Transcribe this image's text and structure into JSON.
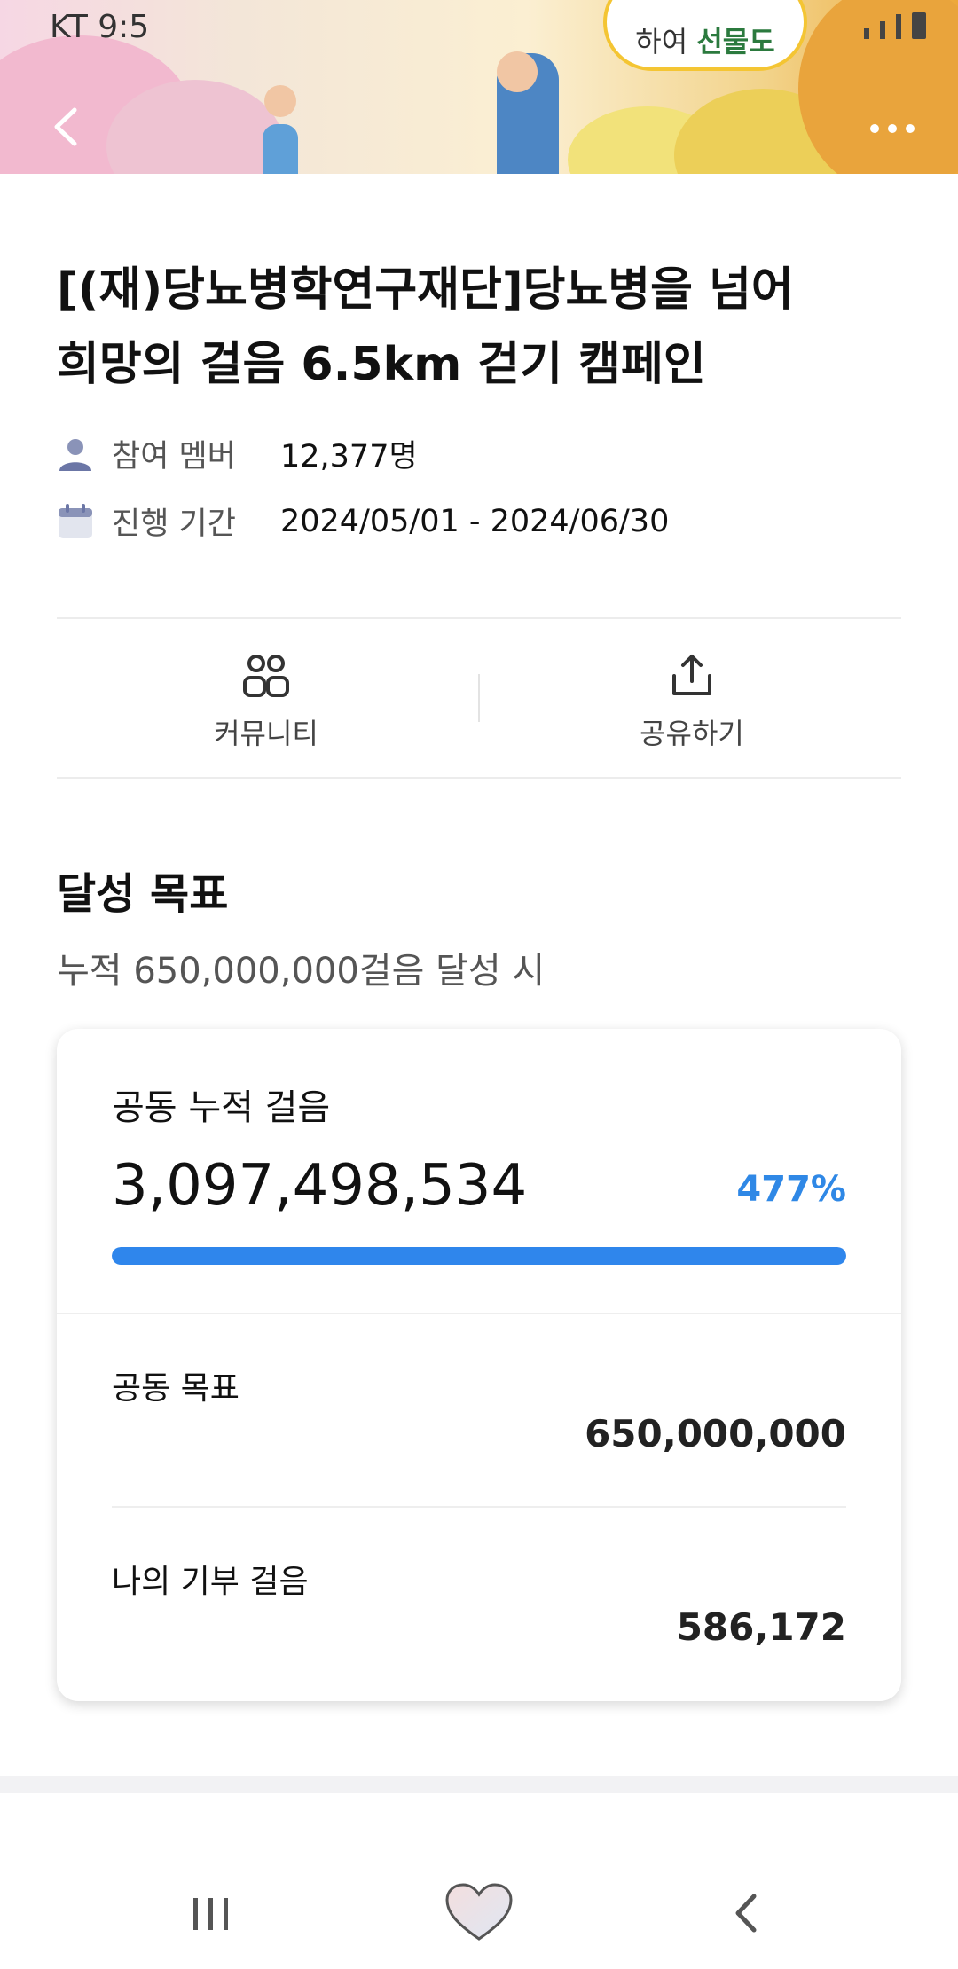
{
  "status_bar": {
    "carrier_time": "KT 9:5"
  },
  "banner": {
    "bubble_line1": "하여 ",
    "bubble_bold": "선물도"
  },
  "campaign": {
    "title_line1": "[(재)당뇨병학연구재단]당뇨병을 넘어",
    "title_line2": "희망의 걸음 6.5km 걷기 캠페인",
    "members_label": "참여 멤버",
    "members_value": "12,377명",
    "period_label": "진행 기간",
    "period_value": "2024/05/01 - 2024/06/30"
  },
  "actions": {
    "community": "커뮤니티",
    "share": "공유하기"
  },
  "goal": {
    "title": "달성 목표",
    "subtitle": "누적 650,000,000걸음 달성 시",
    "cumulative_label": "공동 누적 걸음",
    "cumulative_value": "3,097,498,534",
    "percent": "477%",
    "progress_fraction": 1.0,
    "target_label": "공동 목표",
    "target_value": "650,000,000",
    "my_label": "나의 기부 걸음",
    "my_value": "586,172"
  },
  "colors": {
    "accent": "#2f86ec",
    "percent": "#2f88e6"
  }
}
